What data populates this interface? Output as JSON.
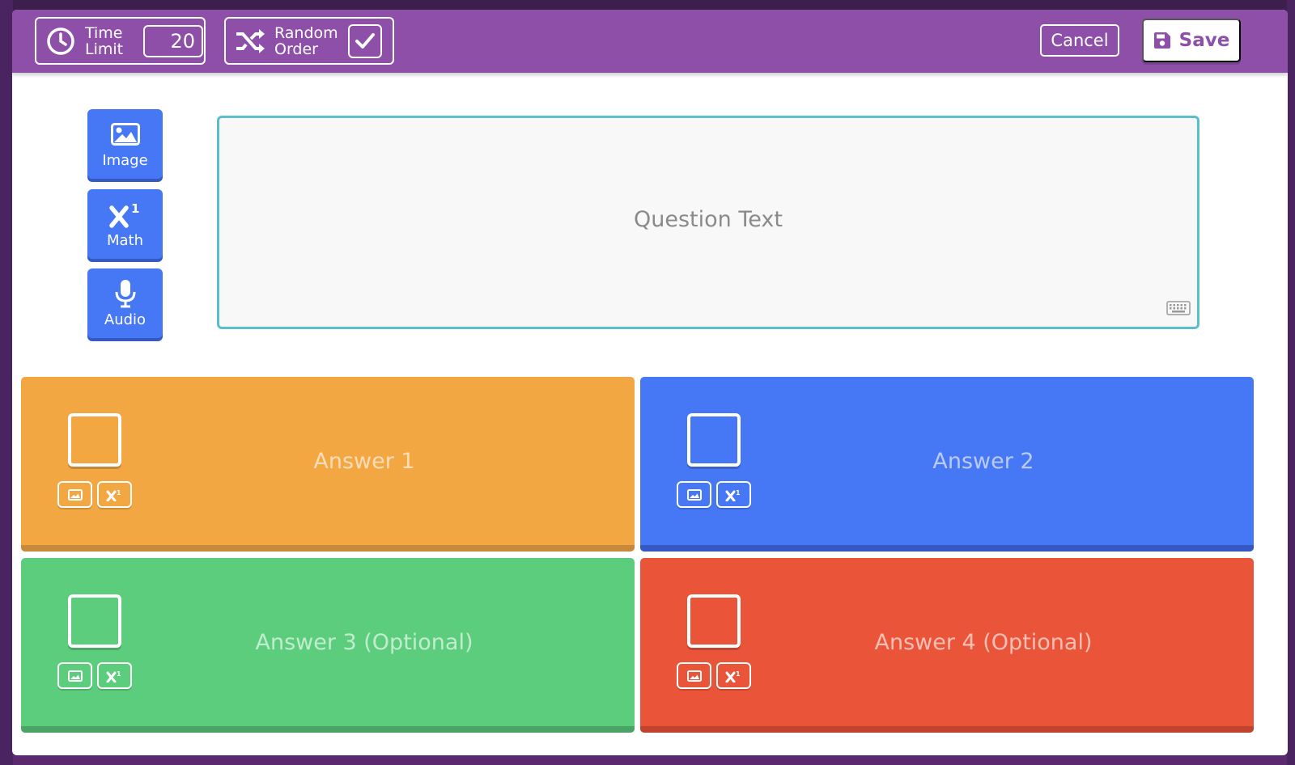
{
  "toolbar": {
    "time_limit_label": "Time\nLimit",
    "time_limit_value": "20",
    "random_order_label": "Random\nOrder",
    "random_order_checked": true,
    "cancel_label": "Cancel",
    "save_label": "Save"
  },
  "media_buttons": {
    "image_label": "Image",
    "math_label": "Math",
    "audio_label": "Audio"
  },
  "question": {
    "placeholder": "Question Text"
  },
  "answers": [
    {
      "placeholder": "Answer 1",
      "color": "#f2a742",
      "correct": false
    },
    {
      "placeholder": "Answer 2",
      "color": "#4677f5",
      "correct": false
    },
    {
      "placeholder": "Answer 3 (Optional)",
      "color": "#5ccd7d",
      "correct": false
    },
    {
      "placeholder": "Answer 4 (Optional)",
      "color": "#ea553a",
      "correct": false
    }
  ],
  "colors": {
    "header": "#8e4fa8",
    "media_button": "#4677f5",
    "question_border": "#5bbfc9"
  },
  "icons": {
    "time_limit": "clock-icon",
    "random_order": "shuffle-icon",
    "checkbox": "check-icon",
    "save": "floppy-disk-icon",
    "image": "image-icon",
    "math": "superscript-icon",
    "audio": "microphone-icon",
    "keyboard": "keyboard-icon"
  }
}
